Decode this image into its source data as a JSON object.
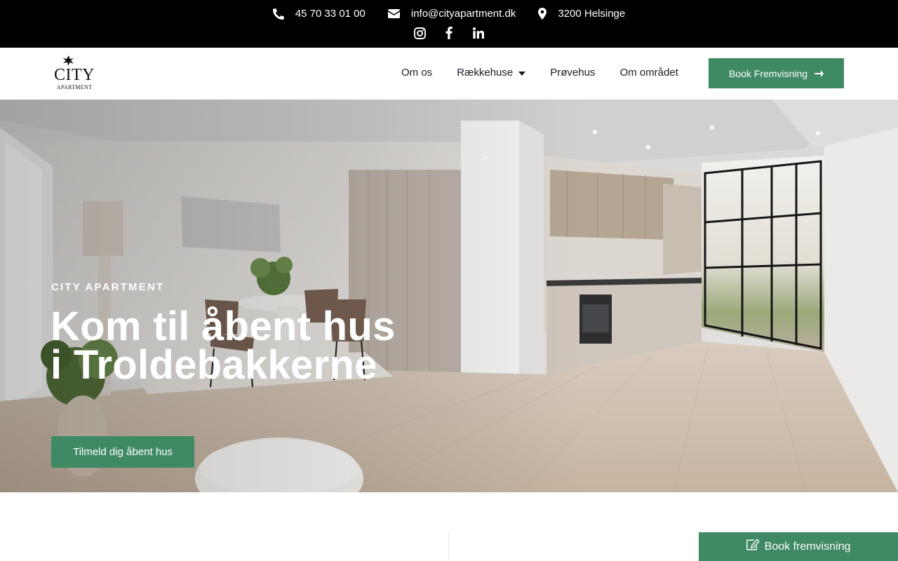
{
  "topbar": {
    "phone": "45 70 33 01 00",
    "email": "info@cityapartment.dk",
    "location": "3200 Helsinge",
    "social": [
      "instagram-icon",
      "facebook-icon",
      "linkedin-icon"
    ]
  },
  "logo": {
    "name": "CITY",
    "sub": "APARTMENT"
  },
  "nav": {
    "items": [
      {
        "label": "Om os"
      },
      {
        "label": "Rækkehuse",
        "has_dropdown": true
      },
      {
        "label": "Prøvehus"
      },
      {
        "label": "Om området"
      }
    ],
    "book_label": "Book Fremvisning"
  },
  "hero": {
    "eyebrow": "CITY APARTMENT",
    "title": "Kom til åbent hus i Troldebakkerne",
    "cta_label": "Tilmeld dig åbent hus"
  },
  "floating": {
    "book_label": "Book fremvisning"
  },
  "colors": {
    "accent": "#3f8a64",
    "topbar_bg": "#000000",
    "nav_text": "#1b1b2b"
  }
}
